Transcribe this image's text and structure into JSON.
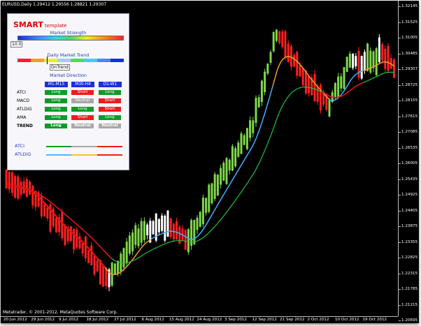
{
  "chart_title": "EURUSD,Daily  1.29412 1.29556 1.28821 1.29307",
  "copyright": "Metatrader, © 2001-2012, MetaQuotes Software Corp.",
  "price_axis": {
    "top_label": "1.32145",
    "labels": [
      "1.31525",
      "1.31005",
      "1.30485",
      "1.29307",
      "1.28725",
      "1.28155",
      "1.27615",
      "1.27085",
      "1.26535",
      "1.26005",
      "1.25435",
      "1.24925",
      "1.24405",
      "1.23875",
      "1.23355",
      "1.22825",
      "1.22315",
      "1.21785",
      "1.21215",
      "1.20695"
    ]
  },
  "date_axis": [
    "20 Jun 2012",
    "29 Jun 2012",
    "9 Jul 2012",
    "18 Jul 2012",
    "27 Jul 2012",
    "6 Aug 2012",
    "15 Aug 2012",
    "24 Aug 2012",
    "3 Sep 2012",
    "12 Sep 2012",
    "21 Sep 2012",
    "2 Oct 2012",
    "10 Oct 2012",
    "19 Oct 2012"
  ],
  "panel": {
    "brand": "SMART",
    "brand_sub": "template",
    "market_strength_title": "Market Strength",
    "market_strength_value": "10.0",
    "daily_trend_title": "Daily Market Trend",
    "daily_trend_value": "DnTrend",
    "market_direction_title": "Market Direction",
    "columns": [
      "M1-M15",
      "M30-H4",
      "D1-W1"
    ],
    "rows": [
      {
        "label": "ATCI",
        "cells": [
          {
            "text": "Long",
            "state": "long"
          },
          {
            "text": "Short",
            "state": "short"
          },
          {
            "text": "Long",
            "state": "long"
          }
        ]
      },
      {
        "label": "MACD",
        "cells": [
          {
            "text": "Long",
            "state": "long"
          },
          {
            "text": "Neutral",
            "state": "neutral"
          },
          {
            "text": "Short",
            "state": "short"
          }
        ]
      },
      {
        "label": "ATLDiG",
        "cells": [
          {
            "text": "Long",
            "state": "long"
          },
          {
            "text": "Long",
            "state": "long"
          },
          {
            "text": "Short",
            "state": "short"
          }
        ]
      },
      {
        "label": "AMA",
        "cells": [
          {
            "text": "Long",
            "state": "long"
          },
          {
            "text": "Short",
            "state": "short"
          },
          {
            "text": "Long",
            "state": "long"
          }
        ]
      },
      {
        "label": "TREND",
        "cells": [
          {
            "text": "Long",
            "state": "long"
          },
          {
            "text": "Neutral",
            "state": "neutral"
          },
          {
            "text": "Neutral",
            "state": "neutral"
          }
        ]
      }
    ],
    "legend": [
      {
        "label": "ATCI",
        "colors": [
          "#0f9a28",
          "#a8a8a8",
          "#ef1c1c"
        ]
      },
      {
        "label": "ATLDiG",
        "colors": [
          "#4fb8ff",
          "#f2c32a",
          "#ef1c1c"
        ]
      }
    ]
  },
  "colors": {
    "bull_bar": "#7fd64a",
    "bear_bar": "#ff2020",
    "neutral_bar": "#ffffff",
    "ma_red": "#e01414",
    "ma_orange": "#f0a020",
    "ma_blue": "#40b0ff",
    "ma_green": "#20c040"
  }
}
